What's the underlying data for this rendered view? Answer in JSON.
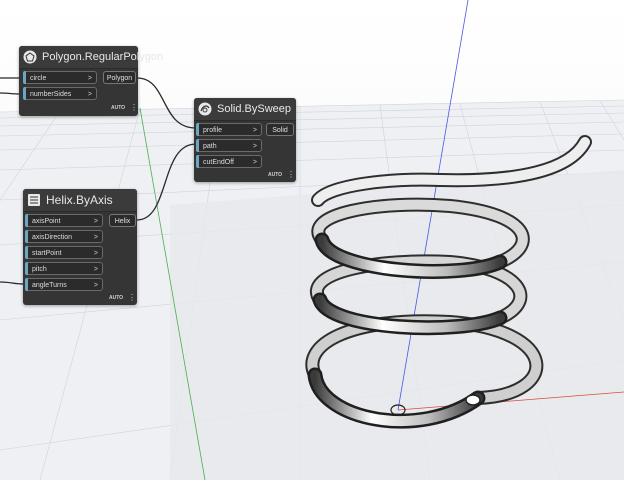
{
  "colors": {
    "node_bg": "#353535",
    "port_accent": "#6aa7c4",
    "axis_x": "#d94c3d",
    "axis_y": "#4caf50",
    "axis_z": "#4a57e6",
    "grid": "#c9ced6"
  },
  "nodes": {
    "polygon": {
      "title": "Polygon.RegularPolygon",
      "icon": "polygon-icon",
      "inputs": [
        "circle",
        "numberSides"
      ],
      "output": "Polygon",
      "lacing": "AUTO"
    },
    "sweep": {
      "title": "Solid.BySweep",
      "icon": "sweep-icon",
      "inputs": [
        "profile",
        "path",
        "cutEndOff"
      ],
      "output": "Solid",
      "lacing": "AUTO"
    },
    "helix": {
      "title": "Helix.ByAxis",
      "icon": "helix-icon",
      "inputs": [
        "axisPoint",
        "axisDirection",
        "startPoint",
        "pitch",
        "angleTurns"
      ],
      "output": "Helix",
      "lacing": "AUTO"
    }
  },
  "arrow_glyph": ">",
  "menu_glyph": "⋮"
}
